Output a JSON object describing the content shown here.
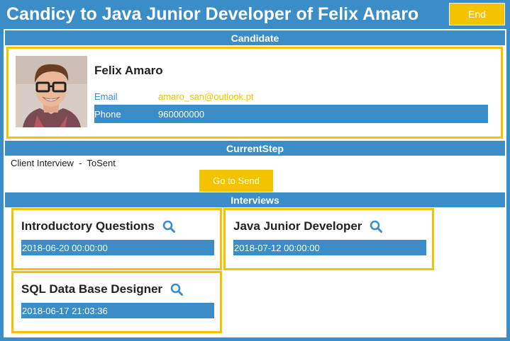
{
  "header": {
    "title": "Candicy to Java Junior Developer of Felix Amaro",
    "end_label": "End"
  },
  "candidate_section": {
    "title": "Candidate",
    "name": "Felix Amaro",
    "email_label": "Email",
    "email_value": "amaro_san@outlook.pt",
    "phone_label": "Phone",
    "phone_value": "960000000"
  },
  "current_step_section": {
    "title": "CurrentStep",
    "step_text": "Client Interview  -  ToSent",
    "action_label": "Go to Send"
  },
  "interviews_section": {
    "title": "Interviews",
    "items": [
      {
        "title": "Introductory Questions",
        "date": "2018-06-20 00:00:00",
        "icon": "search-icon"
      },
      {
        "title": "Java Junior Developer",
        "date": "2018-07-12 00:00:00",
        "icon": "search-icon"
      },
      {
        "title": "SQL Data Base Designer",
        "date": "2018-06-17 21:03:36",
        "icon": "search-icon"
      }
    ]
  },
  "colors": {
    "accent_blue": "#3a8dc7",
    "accent_yellow": "#f3c300"
  }
}
